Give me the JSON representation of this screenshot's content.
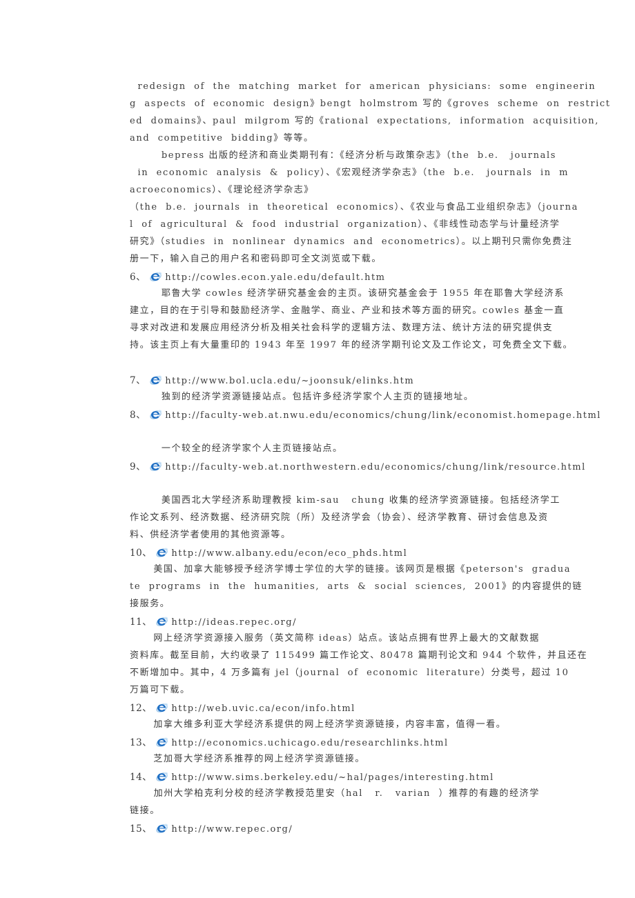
{
  "document": {
    "page_background": "#ffffff",
    "text_color": "#3a3a3a",
    "icon": {
      "name": "internet-explorer-icon",
      "colors": {
        "e_blue": "#1f6fc4",
        "swoosh": "#b9d9f2",
        "highlight": "#6fb2e8"
      }
    }
  },
  "intro": {
    "lines": [
      "  redesign  of  the  matching  market  for  american  physicians:  some  engineerin",
      "g  aspects  of  economic  design》bengt  holmstrom 写的《groves  scheme  on  restrict",
      "ed  domains》、paul  milgrom 写的《rational  expectations,  information  acquisition,",
      "and  competitive  bidding》等等。"
    ]
  },
  "bepress": {
    "lines": [
      "        bepress 出版的经济和商业类期刊有：《经济分析与政策杂志》（the  b.e.   journals",
      "  in  economic  analysis  &  policy）、《宏观经济学杂志》（the  b.e.   journals  in  m",
      "acroeconomics）、《理论经济学杂志》",
      "（the  b.e.  journals  in  theoretical  economics）、《农业与食品工业组织杂志》（journa",
      "l  of  agricultural  &  food  industrial  organization）、《非线性动态学与计量经济学",
      "研究》（studies  in  nonlinear  dynamics  and  econometrics）。以上期刊只需你免费注",
      "册一下，输入自己的用户名和密码即可全文浏览或下载。"
    ]
  },
  "items": [
    {
      "number": "6、",
      "url": "http://cowles.econ.yale.edu/default.htm",
      "description_lines": [
        "        耶鲁大学 cowles 经济学研究基金会的主页。该研究基金会于 1955 年在耶鲁大学经济系",
        "建立，目的在于引导和鼓励经济学、金融学、商业、产业和技术等方面的研究。cowles 基金一直",
        "寻求对改进和发展应用经济分析及相关社会科学的逻辑方法、数理方法、统计方法的研究提供支",
        "持。该主页上有大量重印的 1943 年至 1997 年的经济学期刊论文及工作论文，可免费全文下载。"
      ],
      "blank_after": true
    },
    {
      "number": "7、",
      "url": "http://www.bol.ucla.edu/~joonsuk/elinks.htm",
      "description_lines": [
        "        独到的经济学资源链接站点。包括许多经济学家个人主页的链接地址。"
      ],
      "blank_after": false
    },
    {
      "number": "8、",
      "url": "http://faculty-web.at.nwu.edu/economics/chung/link/economist.homepage.html",
      "blank_before_description": true,
      "description_lines": [
        "        一个较全的经济学家个人主页链接站点。"
      ],
      "blank_after": false
    },
    {
      "number": "9、",
      "url": "http://faculty-web.at.northwestern.edu/economics/chung/link/resource.html",
      "blank_before_description": true,
      "description_lines": [
        "        美国西北大学经济系助理教授 kim-sau   chung 收集的经济学资源链接。包括经济学工",
        "作论文系列、经济数据、经济研究院（所）及经济学会（协会）、经济学教育、研讨会信息及资",
        "料、供经济学者使用的其他资源等。"
      ],
      "blank_after": false
    },
    {
      "number": "10、",
      "url": "http://www.albany.edu/econ/eco_phds.html",
      "description_lines": [
        "      美国、加拿大能够授予经济学博士学位的大学的链接。该网页是根据《peterson's  gradua",
        "te  programs  in  the  humanities,  arts  &  social  sciences,  2001》的内容提供的链",
        "接服务。"
      ],
      "blank_after": false
    },
    {
      "number": "11、",
      "url": "http://ideas.repec.org/",
      "description_lines": [
        "      网上经济学资源接入服务（英文简称 ideas）站点。该站点拥有世界上最大的文献数据",
        "资料库。截至目前，大约收录了 115499 篇工作论文、80478 篇期刊论文和 944 个软件，并且还在",
        "不断增加中。其中，4 万多篇有 jel（journal  of  economic  literature）分类号，超过 10",
        "万篇可下载。"
      ],
      "blank_after": false
    },
    {
      "number": "12、",
      "url": "http://web.uvic.ca/econ/info.html",
      "description_lines": [
        "      加拿大维多利亚大学经济系提供的网上经济学资源链接，内容丰富，值得一看。"
      ],
      "blank_after": false
    },
    {
      "number": "13、",
      "url": "http://economics.uchicago.edu/researchlinks.html",
      "description_lines": [
        "      芝加哥大学经济系推荐的网上经济学资源链接。"
      ],
      "blank_after": false
    },
    {
      "number": "14、",
      "url": "http://www.sims.berkeley.edu/~hal/pages/interesting.html",
      "description_lines": [
        "      加州大学柏克利分校的经济学教授范里安（hal   r.   varian  ）推荐的有趣的经济学",
        "链接。"
      ],
      "blank_after": false
    },
    {
      "number": "15、",
      "url": "http://www.repec.org/",
      "description_lines": [],
      "blank_after": false
    }
  ]
}
